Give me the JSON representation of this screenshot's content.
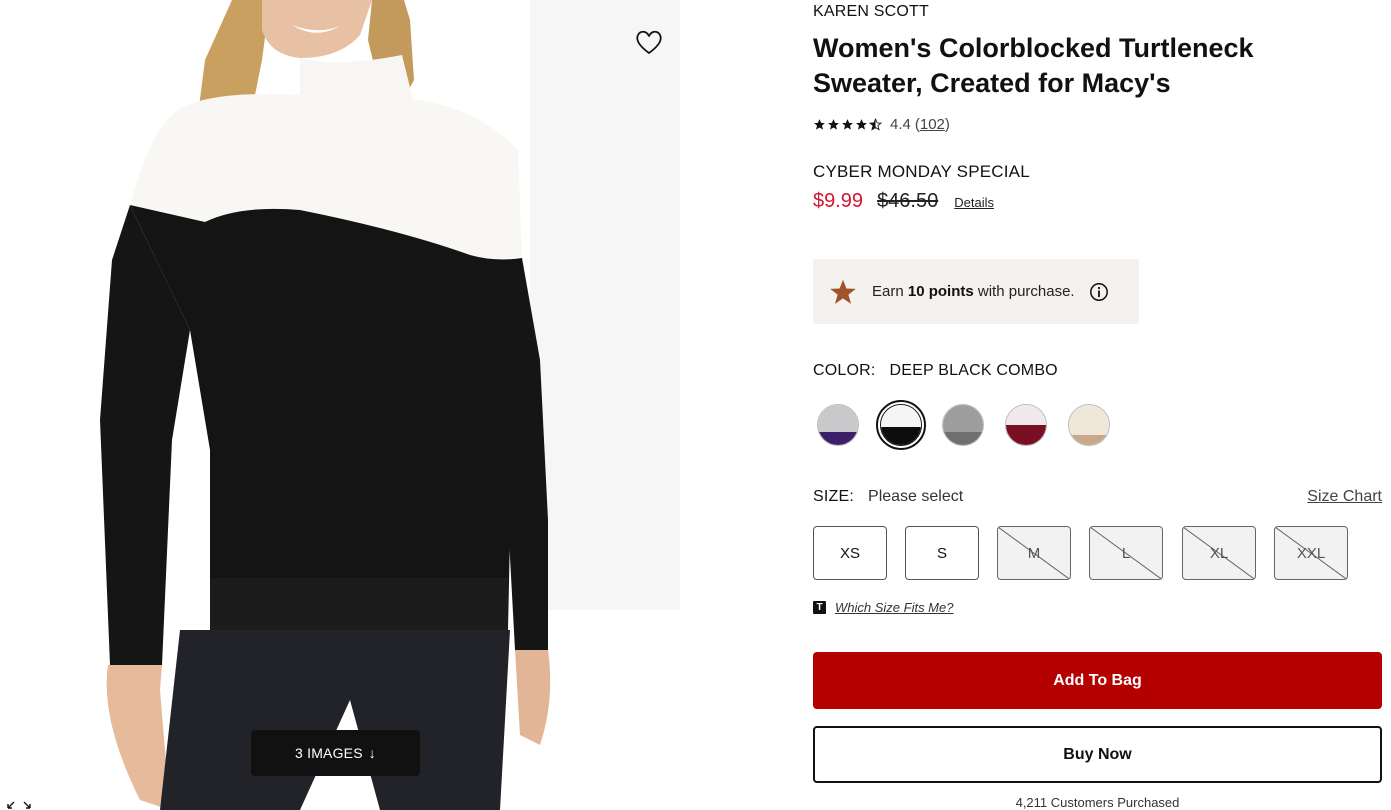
{
  "gallery": {
    "images_button_label": "3 IMAGES",
    "images_button_arrow": "↓",
    "wishlist_icon": "heart-outline-icon",
    "expand_icon": "expand-arrows-icon"
  },
  "product": {
    "brand": "KAREN SCOTT",
    "title": "Women's Colorblocked Turtleneck Sweater, Created for Macy's",
    "rating": {
      "stars": 4.4,
      "value_label": "4.4",
      "count_open": "(",
      "count_label": "102",
      "count_close": ")"
    },
    "promo": "CYBER MONDAY SPECIAL",
    "sale_price": "$9.99",
    "original_price": "$46.50",
    "details_label": "Details",
    "points": {
      "prefix": "Earn ",
      "amount": "10 points",
      "suffix": " with purchase."
    },
    "color": {
      "label": "COLOR:",
      "selected": "DEEP BLACK COMBO",
      "swatches": [
        {
          "top": "#c9c9cc",
          "bottom": "#3b1f6b",
          "selected": false
        },
        {
          "top": "#f5f5f5",
          "bottom": "#0d0d0d",
          "selected": true
        },
        {
          "top": "#9d9d9d",
          "bottom": "#6f6f6f",
          "selected": false
        },
        {
          "top": "#f2e9ec",
          "bottom": "#7a0f24",
          "selected": false
        },
        {
          "top": "#efe7d9",
          "bottom": "#c9a98a",
          "selected": false
        }
      ]
    },
    "size": {
      "label": "SIZE:",
      "value": "Please select",
      "chart_label": "Size Chart",
      "options": [
        {
          "label": "XS",
          "available": true
        },
        {
          "label": "S",
          "available": true
        },
        {
          "label": "M",
          "available": false
        },
        {
          "label": "L",
          "available": false
        },
        {
          "label": "XL",
          "available": false
        },
        {
          "label": "XXL",
          "available": false
        }
      ]
    },
    "fit_icon_letter": "T",
    "fit_label": "Which Size Fits Me?",
    "add_to_bag_label": "Add To Bag",
    "buy_now_label": "Buy Now",
    "purchased_label": "4,211 Customers Purchased"
  },
  "colors": {
    "sale": "#d31432",
    "add_to_bag": "#b50000",
    "points_bg": "#f4f1ef",
    "points_star": "#a0522d"
  }
}
